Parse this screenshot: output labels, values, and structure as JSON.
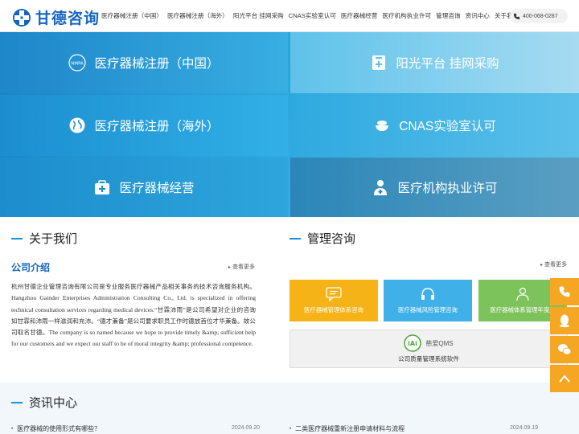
{
  "header": {
    "logo_text": "甘德咨询",
    "nav": [
      "医疗器械注册（中国）",
      "医疗器械注册（海外）",
      "阳光平台 挂网采购",
      "CNAS实验室认可",
      "医疗器械经营",
      "医疗机构执业许可",
      "管理咨询",
      "资讯中心",
      "关于我们"
    ],
    "phone": "400-068-0287"
  },
  "tiles": [
    {
      "label": "医疗器械注册（中国）",
      "icon": "nmpa-badge-icon",
      "badge": "NMPA"
    },
    {
      "label": "阳光平台 挂网采购",
      "icon": "medical-cabinet-icon"
    },
    {
      "label": "医疗器械注册（海外）",
      "icon": "globe-icon"
    },
    {
      "label": "CNAS实验室认可",
      "icon": "lab-bowl-icon"
    },
    {
      "label": "医疗器械经营",
      "icon": "medical-kit-icon"
    },
    {
      "label": "医疗机构执业许可",
      "icon": "doctor-icon"
    }
  ],
  "about": {
    "title": "关于我们",
    "intro_heading": "公司介绍",
    "more": "查看更多",
    "text": "杭州甘德企业管理咨询有限公司是专业服务医疗器械产品相关事务的技术咨询服务机构。 Hangzhou Gainder Enterprises Administration Consulting Co., Ltd. is specialized in offering technical consultation services regarding medical devices.“甘霖沛雨”是公司希望对企业的咨询如甘霖和沛雨一样滋润和充沛。“德才兼备”是公司要求职员工作时德放首位才华兼备。故公司取名甘德。The company is so named because we hope to provide timely &amp; sufficient help for our customers and we expect our staff to be of moral integrity &amp; professional competence."
  },
  "mgmt": {
    "title": "管理咨询",
    "more": "查看更多",
    "cards": [
      {
        "label": "医疗器械管理体系咨询",
        "icon": "chat-icon",
        "color": "#f5b318"
      },
      {
        "label": "医疗器械风险管理咨询",
        "icon": "headset-icon",
        "color": "#3fb0e8"
      },
      {
        "label": "医疗器械体系管理年度服",
        "icon": "person-icon",
        "color": "#7dc35b"
      }
    ],
    "qms_brand": "慈爱QMS",
    "qms_logo": "iAi",
    "qms_label": "公司质量管理系统软件"
  },
  "news": {
    "title": "资讯中心",
    "items": [
      {
        "title": "医疗器械的使用形式有哪些？",
        "date": "2024.09.20"
      },
      {
        "title": "二类医疗器械重新注册申请材料与流程",
        "date": "2024.09.19"
      }
    ]
  },
  "sidebar": [
    "phone-icon",
    "qq-icon",
    "wechat-icon",
    "back-to-top-icon"
  ],
  "colors": {
    "brand": "#1565c0",
    "accent": "#1a8fd8",
    "orange": "#f5a623"
  }
}
